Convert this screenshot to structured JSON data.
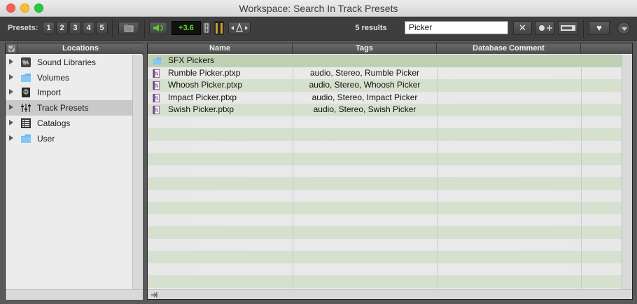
{
  "window": {
    "title": "Workspace: Search In Track Presets"
  },
  "toolbar": {
    "presets_label": "Presets:",
    "preset_buttons": [
      "1",
      "2",
      "3",
      "4",
      "5"
    ],
    "level": "+3.6",
    "results": "5 results",
    "search_value": "Picker",
    "search_placeholder": "Search"
  },
  "locations": {
    "header": "Locations",
    "items": [
      {
        "label": "Sound Libraries",
        "icon": "sound-libraries-icon"
      },
      {
        "label": "Volumes",
        "icon": "folder-icon"
      },
      {
        "label": "Import",
        "icon": "import-icon"
      },
      {
        "label": "Track Presets",
        "icon": "track-presets-icon"
      },
      {
        "label": "Catalogs",
        "icon": "catalogs-icon"
      },
      {
        "label": "User",
        "icon": "folder-icon"
      }
    ],
    "selected": "Track Presets"
  },
  "results_table": {
    "columns": [
      "Name",
      "Tags",
      "Database Comment"
    ],
    "rows": [
      {
        "name": "SFX Pickers",
        "tags": "",
        "comment": "",
        "type": "folder"
      },
      {
        "name": "Rumble Picker.ptxp",
        "tags": "audio, Stereo, Rumble Picker",
        "comment": "",
        "type": "preset"
      },
      {
        "name": "Whoosh Picker.ptxp",
        "tags": "audio, Stereo, Whoosh Picker",
        "comment": "",
        "type": "preset"
      },
      {
        "name": "Impact Picker.ptxp",
        "tags": "audio, Stereo, Impact Picker",
        "comment": "",
        "type": "preset"
      },
      {
        "name": "Swish Picker.ptxp",
        "tags": "audio, Stereo, Swish Picker",
        "comment": "",
        "type": "preset"
      }
    ]
  },
  "colors": {
    "accent_level": "#59e32a",
    "selected_row": "#bfd0b2",
    "alt_row": "#d6e0cf",
    "folder_blue": "#6bb8f0"
  }
}
